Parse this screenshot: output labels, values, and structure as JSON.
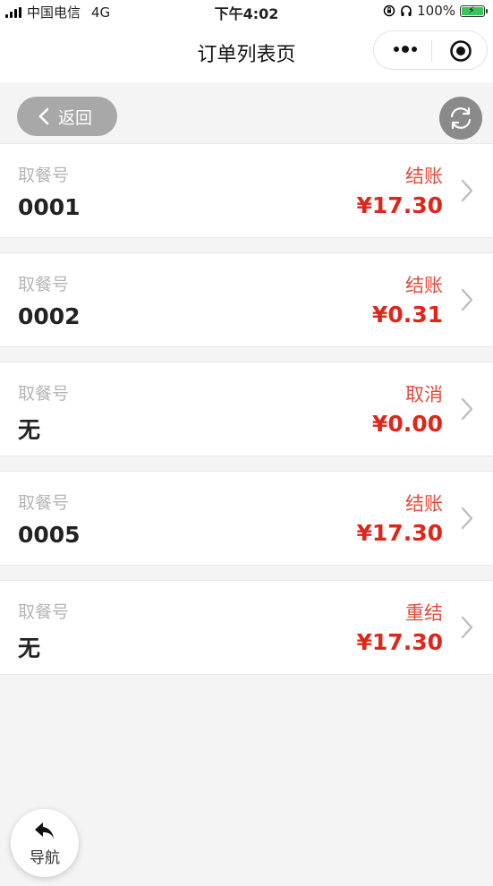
{
  "status_bar": {
    "carrier": "中国电信",
    "network": "4G",
    "time": "下午4:02",
    "battery": "100%"
  },
  "nav": {
    "title": "订单列表页"
  },
  "toolbar": {
    "back_label": "返回"
  },
  "orders": [
    {
      "label": "取餐号",
      "number": "0001",
      "status": "结账",
      "amount": "¥17.30"
    },
    {
      "label": "取餐号",
      "number": "0002",
      "status": "结账",
      "amount": "¥0.31"
    },
    {
      "label": "取餐号",
      "number": "无",
      "status": "取消",
      "amount": "¥0.00"
    },
    {
      "label": "取餐号",
      "number": "0005",
      "status": "结账",
      "amount": "¥17.30"
    },
    {
      "label": "取餐号",
      "number": "无",
      "status": "重结",
      "amount": "¥17.30"
    }
  ],
  "float_nav": {
    "label": "导航"
  },
  "colors": {
    "accent_red": "#e0261b",
    "status_red": "#e64a3b",
    "background": "#f4f4f4"
  },
  "icons": {
    "signal": "signal-bars-icon",
    "lock": "orientation-lock-icon",
    "headphones": "headphones-icon",
    "battery": "battery-charging-icon",
    "more": "more-dots-icon",
    "close": "target-close-icon",
    "back": "chevron-left-icon",
    "refresh": "refresh-icon",
    "chevron": "chevron-right-icon",
    "reply": "reply-arrow-icon"
  }
}
